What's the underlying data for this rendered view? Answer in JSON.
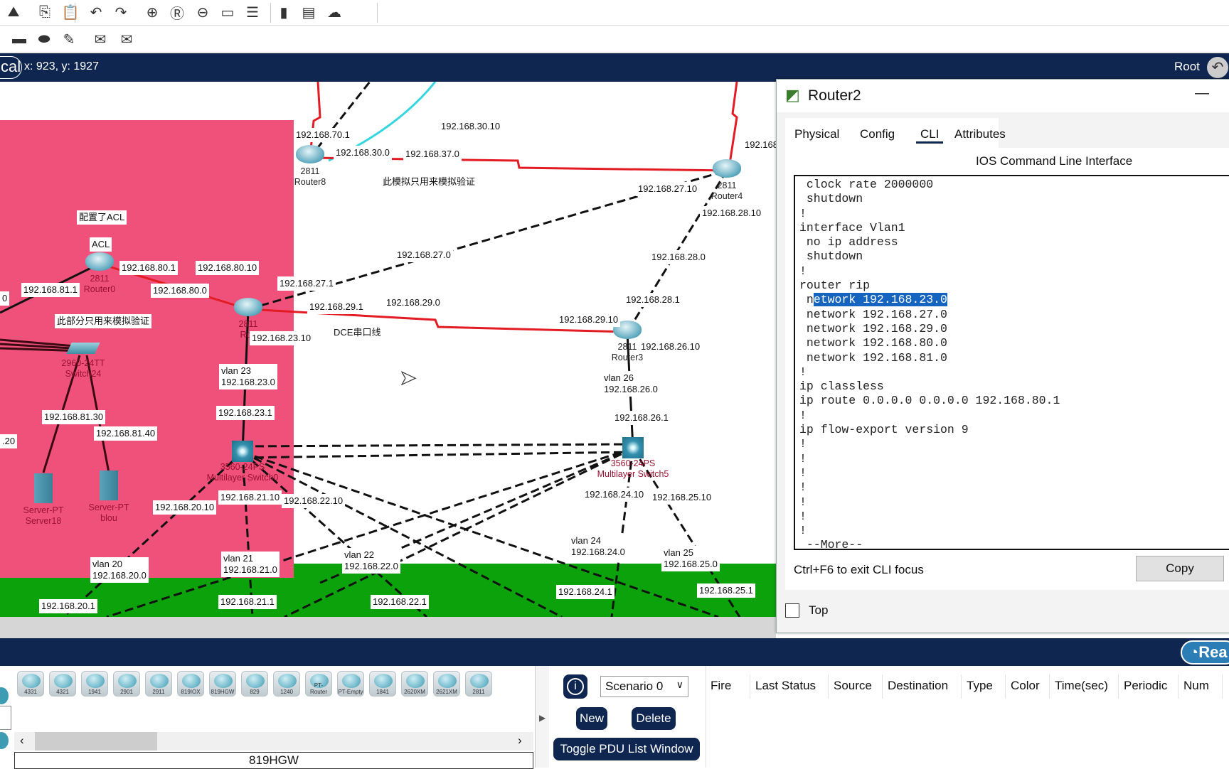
{
  "toolbar": {
    "row1_icons": [
      "network-info-icon",
      "copy-icon",
      "paste-icon",
      "undo-icon",
      "redo-icon",
      "zoom-in-icon",
      "zoom-reset-icon",
      "zoom-out-icon",
      "drawing-palette-icon",
      "custom-device-dialog-icon",
      "viewport-icon",
      "physical-view-icon",
      "cloud-icon"
    ],
    "row2_icons": [
      "rectangle-icon",
      "ellipse-icon",
      "freeform-icon",
      "add-simple-pdu-icon",
      "add-complex-pdu-icon"
    ]
  },
  "navbar": {
    "mode_label": "cal",
    "coordinates": "x: 923, y: 1927",
    "root_label": "Root"
  },
  "canvas": {
    "colors": {
      "pink_area": "#f0517a",
      "green_area": "#0ba20b",
      "serial_link": "#e31b23",
      "copper_link": "#111111",
      "fiber_link": "#35d6e0"
    },
    "labels": [
      "192.168.70.1",
      "192.168.30.0",
      "192.168.37.0",
      "192.168.30.10",
      "此模拟只用来模拟验证",
      "192.168",
      "192.168.27.10",
      "192.168.28.10",
      "192.168.28.0",
      "192.168.27.0",
      "192.168.27.1",
      "192.168.29.1",
      "192.168.29.0",
      "192.168.28.1",
      "192.168.29.10",
      "192.168.26.10",
      "DCE串口线",
      "配置了ACL",
      "ACL",
      "192.168.80.1",
      "192.168.80.10",
      "192.168.80.0",
      "192.168.81.1",
      "此部分只用来模拟验证",
      "192.168.23.10",
      "vlan 23\n192.168.23.0",
      "192.168.23.1",
      "vlan 26\n192.168.26.0",
      "192.168.26.1",
      "192.168.81.30",
      "192.168.81.40",
      ".20",
      "192.168.20.10",
      "192.168.21.10",
      "192.168.22.10",
      "192.168.24.10",
      "192.168.25.10",
      "vlan 24\n192.168.24.0",
      "vlan 25\n192.168.25.0",
      "vlan 20\n192.168.20.0",
      "vlan 21\n192.168.21.0",
      "vlan 22\n192.168.22.0",
      "192.168.20.1",
      "192.168.21.1",
      "192.168.22.1",
      "192.168.24.1",
      "192.168.25.1",
      "0"
    ],
    "devices": [
      {
        "model": "2811",
        "name": "Router8",
        "type": "router"
      },
      {
        "model": "2811",
        "name": "Router4",
        "type": "router"
      },
      {
        "model": "2811",
        "name": "Router0",
        "type": "router"
      },
      {
        "model": "2811",
        "name": "Rou",
        "type": "router"
      },
      {
        "model": "2811",
        "name": "Router3",
        "type": "router"
      },
      {
        "model": "2960-24TT",
        "name": "Switch24",
        "type": "switch"
      },
      {
        "model": "3560-24PS",
        "name": "Multilayer Switch0",
        "type": "multilayer-switch"
      },
      {
        "model": "3560-24PS",
        "name": "Multilayer Switch5",
        "type": "multilayer-switch"
      },
      {
        "model": "Server-PT",
        "name": "Server18",
        "type": "server"
      },
      {
        "model": "Server-PT",
        "name": "blou",
        "type": "server"
      }
    ]
  },
  "device_window": {
    "title": "Router2",
    "minimize": "—",
    "tabs": [
      {
        "label": "Physical"
      },
      {
        "label": "Config"
      },
      {
        "label": "CLI",
        "active": true
      },
      {
        "label": "Attributes"
      }
    ],
    "cli_heading": "IOS Command Line Interface",
    "cli_lines": [
      " clock rate 2000000",
      " shutdown",
      "!",
      "interface Vlan1",
      " no ip address",
      " shutdown",
      "!",
      "router rip",
      " network 192.168.23.0",
      " network 192.168.27.0",
      " network 192.168.29.0",
      " network 192.168.80.0",
      " network 192.168.81.0",
      "!",
      "ip classless",
      "ip route 0.0.0.0 0.0.0.0 192.168.80.1",
      "!",
      "ip flow-export version 9",
      "!",
      "!",
      "!",
      "!",
      "!",
      "!",
      "!",
      " --More--"
    ],
    "cli_selection": {
      "line": 8,
      "selected_text": "etwork 192.168.23.0"
    },
    "hint": "Ctrl+F6 to exit CLI focus",
    "copy_label": "Copy",
    "top_label": "Top",
    "top_checked": false
  },
  "bottom": {
    "realtime_label": "Rea",
    "device_models": [
      "4331",
      "4321",
      "1941",
      "2901",
      "2911",
      "819IOX",
      "819HGW",
      "829",
      "1240",
      "PT-Router",
      "PT-Empty",
      "1841",
      "2620XM",
      "2621XM",
      "2811"
    ],
    "selected_model": "819HGW",
    "scenario": "Scenario 0",
    "new_label": "New",
    "delete_label": "Delete",
    "toggle_label": "Toggle PDU List Window",
    "pdu_columns": [
      "Fire",
      "Last Status",
      "Source",
      "Destination",
      "Type",
      "Color",
      "Time(sec)",
      "Periodic",
      "Num"
    ]
  }
}
